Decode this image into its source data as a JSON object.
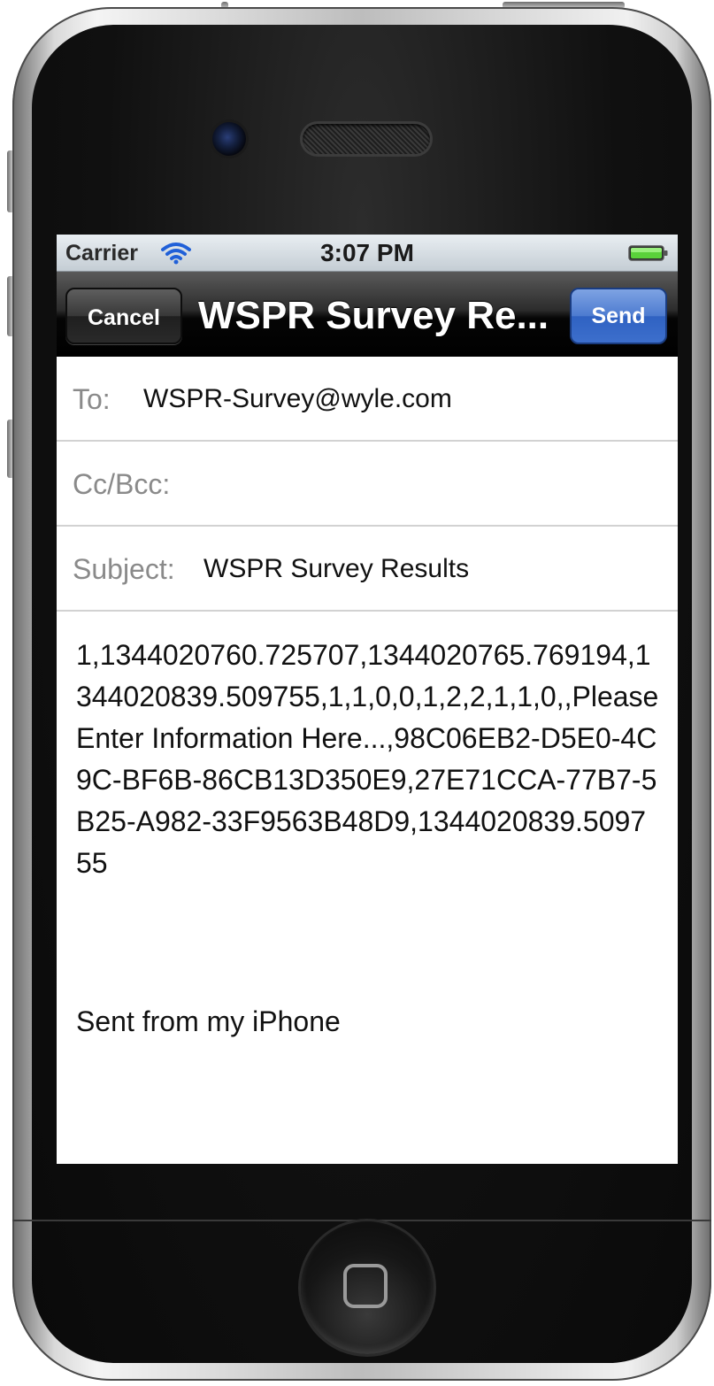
{
  "status_bar": {
    "carrier": "Carrier",
    "time": "3:07 PM",
    "wifi_icon": "wifi-icon",
    "battery_icon": "battery-icon",
    "battery_color": "#5ad13a"
  },
  "nav_bar": {
    "cancel_label": "Cancel",
    "title": "WSPR Survey Re...",
    "send_label": "Send",
    "send_color": "#3d6fcc"
  },
  "compose": {
    "to": {
      "label": "To:",
      "value": "WSPR-Survey@wyle.com"
    },
    "cc_bcc": {
      "label": "Cc/Bcc:",
      "value": ""
    },
    "subject": {
      "label": "Subject:",
      "value": "WSPR Survey Results"
    },
    "body": "1,1344020760.725707,1344020765.769194,1344020839.509755,1,1,0,0,1,2,2,1,1,0,,Please Enter Information Here...,98C06EB2-D5E0-4C9C-BF6B-86CB13D350E9,27E71CCA-77B7-5B25-A982-33F9563B48D9,1344020839.509755",
    "signature": "Sent from my iPhone"
  },
  "device": {
    "home_button_icon": "home-button-icon"
  }
}
